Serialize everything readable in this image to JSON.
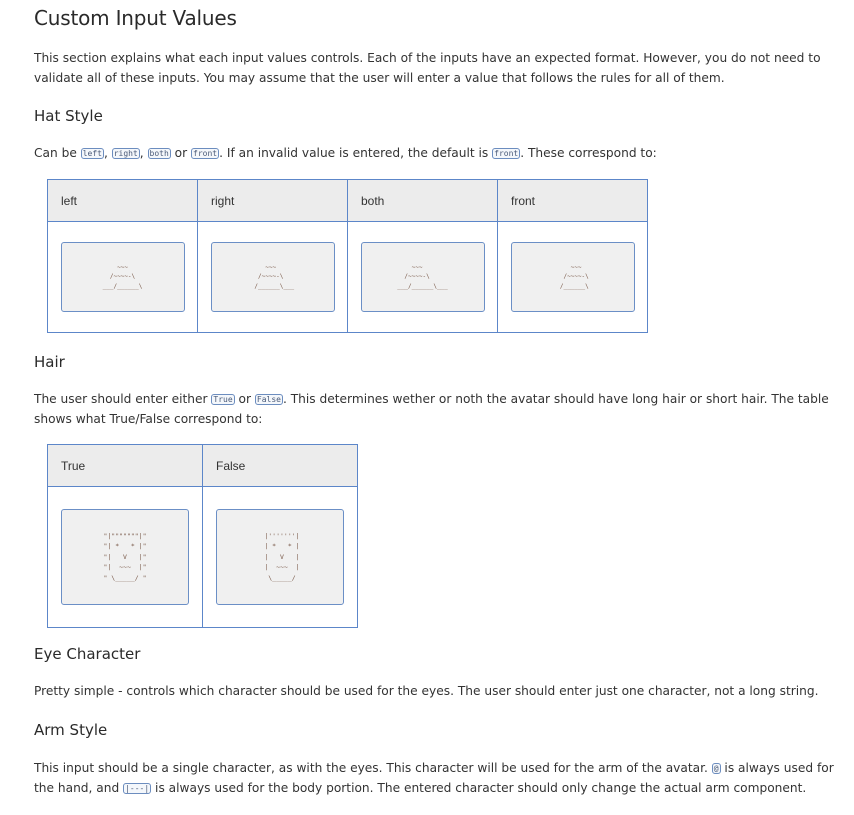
{
  "title": "Custom Input Values",
  "intro": "This section explains what each input values controls. Each of the inputs have an expected format. However, you do not need to validate all of these inputs. You may assume that the user will enter a value that follows the rules for all of them.",
  "hat_style": {
    "heading": "Hat Style",
    "text_prefix": "Can be ",
    "codes": [
      "left",
      "right",
      "both",
      "front"
    ],
    "sep_comma": ", ",
    "sep_or": " or ",
    "text_mid": ". If an invalid value is entered, the default is ",
    "default_code": "front",
    "text_suffix": ". These correspond to:",
    "table": {
      "headers": [
        "left",
        "right",
        "both",
        "front"
      ],
      "art": [
        "    ~~~\n  /~~~~-\\\n___/______\\",
        "    ~~~\n  /~~~~-\\\n /______\\___",
        "    ~~~\n  /~~~~-\\\n___/______\\___",
        "    ~~~\n  /~~~~-\\\n /______\\"
      ]
    }
  },
  "hair": {
    "heading": "Hair",
    "text_prefix": "The user should enter either ",
    "code_true": "True",
    "sep_or": " or ",
    "code_false": "False",
    "text_suffix": ". This determines wether or noth the avatar should have long hair or short hair. The table shows what True/False correspond to:",
    "table": {
      "headers": [
        "True",
        "False"
      ],
      "art": [
        "\"|\"\"\"\"\"\"\"|\"\n\"| *   * |\"\n\"|   V   |\"\n\"|  ~~~  |\"\n\" \\_____/ \"",
        " |'''''''|\n | *   * |\n |   V   |\n |  ~~~  |\n  \\_____/"
      ]
    }
  },
  "eye_character": {
    "heading": "Eye Character",
    "text": "Pretty simple - controls which character should be used for the eyes. The user should enter just one character, not a long string."
  },
  "arm_style": {
    "heading": "Arm Style",
    "text_prefix": "This input should be a single character, as with the eyes. This character will be used for the arm of the avatar. ",
    "code_hand": "@",
    "text_mid": " is always used for the hand, and ",
    "code_body": "|---|",
    "text_suffix": " is always used for the body portion. The entered character should only change the actual arm component."
  }
}
